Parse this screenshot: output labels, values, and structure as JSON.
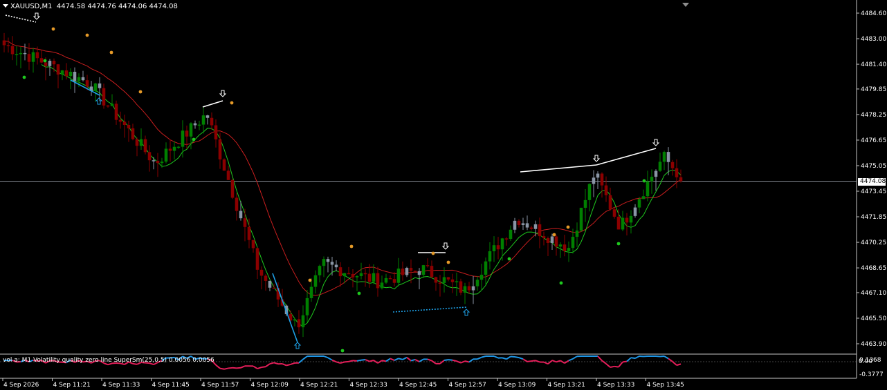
{
  "header": {
    "symbol": "XAUUSD,M1",
    "ohlc": "4474.58 4474.76 4474.06 4474.08"
  },
  "price_axis": {
    "labels": [
      "4484.60",
      "4483.00",
      "4481.40",
      "4479.85",
      "4478.25",
      "4476.65",
      "4475.05",
      "4473.45",
      "4471.85",
      "4470.25",
      "4468.65",
      "4467.10",
      "4465.50",
      "4463.90"
    ],
    "current": "4474.08"
  },
  "time_axis": {
    "labels": [
      "4 Sep 2026",
      "4 Sep 11:21",
      "4 Sep 11:33",
      "4 Sep 11:45",
      "4 Sep 11:57",
      "4 Sep 12:09",
      "4 Sep 12:21",
      "4 Sep 12:33",
      "4 Sep 12:45",
      "4 Sep 12:57",
      "4 Sep 13:09",
      "4 Sep 13:21",
      "4 Sep 13:33",
      "4 Sep 13:45"
    ]
  },
  "indicator": {
    "label": "vol a: M1 Volatility quality zero line SuperSm(25,0.5) 0.0056 0.0056",
    "axis_labels": [
      "0.1368",
      "-0.3777"
    ],
    "zero_label": "0.00"
  },
  "colors": {
    "bull": "#008000",
    "bear": "#8b0000",
    "neutral": "#8a95a5",
    "ma": "#c81e1e",
    "signal": "#1ec81e",
    "trend_down": "#1ea0e6",
    "trend_up": "#ffffff",
    "ind_up": "#1e96e6",
    "ind_down": "#e61e5a"
  },
  "chart_data": {
    "type": "candlestick",
    "symbol": "XAUUSD",
    "timeframe": "M1",
    "ylim": [
      4463.3,
      4485.2
    ],
    "last_price": 4474.08,
    "key_closes": [
      {
        "t": "11:10",
        "v": 4482.6
      },
      {
        "t": "11:22",
        "v": 4481.2
      },
      {
        "t": "11:30",
        "v": 4480.2
      },
      {
        "t": "11:45",
        "v": 4475.2
      },
      {
        "t": "11:57",
        "v": 4478.3
      },
      {
        "t": "12:09",
        "v": 4468.5
      },
      {
        "t": "12:18",
        "v": 4465.0
      },
      {
        "t": "12:24",
        "v": 4468.9
      },
      {
        "t": "12:37",
        "v": 4467.8
      },
      {
        "t": "12:47",
        "v": 4468.6
      },
      {
        "t": "12:57",
        "v": 4467.2
      },
      {
        "t": "13:09",
        "v": 4471.8
      },
      {
        "t": "13:21",
        "v": 4469.9
      },
      {
        "t": "13:27",
        "v": 4474.6
      },
      {
        "t": "13:33",
        "v": 4471.2
      },
      {
        "t": "13:43",
        "v": 4475.6
      },
      {
        "t": "13:48",
        "v": 4474.08
      }
    ]
  }
}
